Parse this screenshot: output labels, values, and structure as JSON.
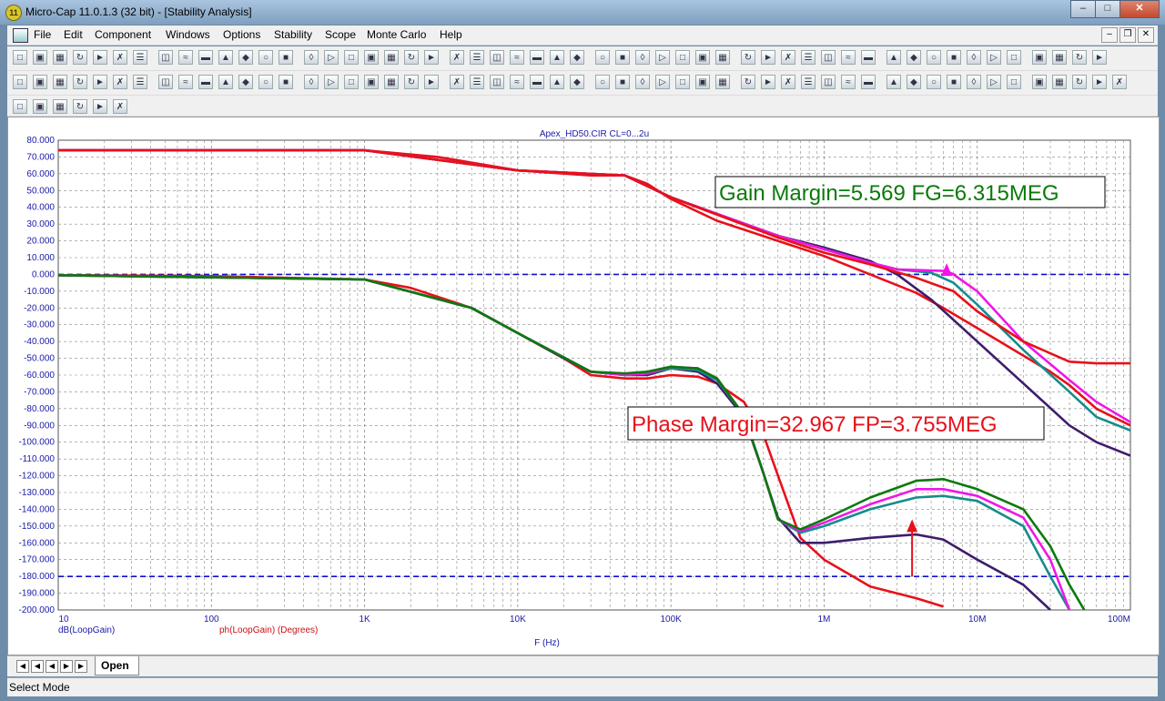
{
  "window": {
    "title": "Micro-Cap 11.0.1.3 (32 bit) - [Stability Analysis]",
    "app_icon_glyph": "11"
  },
  "menu": [
    "File",
    "Edit",
    "Component",
    "Windows",
    "Options",
    "Stability",
    "Scope",
    "Monte Carlo",
    "Help"
  ],
  "plot": {
    "title": "Apex_HD50.CIR CL=0...2u",
    "xlabel": "F (Hz)",
    "legend_left": "dB(LoopGain)",
    "legend_right": "ph(LoopGain) (Degrees)",
    "gain_annotation": "Gain Margin=5.569 FG=6.315MEG",
    "phase_annotation": "Phase Margin=32.967 FP=3.755MEG"
  },
  "tabs": {
    "active": "Open"
  },
  "status": "Select Mode",
  "chart_data": {
    "type": "line",
    "x_scale": "log",
    "xlim": [
      10,
      100000000
    ],
    "ylim": [
      -200,
      80
    ],
    "x_ticks": [
      "10",
      "100",
      "1K",
      "10K",
      "100K",
      "1M",
      "10M",
      "100M"
    ],
    "y_ticks": [
      "80.000",
      "70.000",
      "60.000",
      "50.000",
      "40.000",
      "30.000",
      "20.000",
      "10.000",
      "0.000",
      "-10.000",
      "-20.000",
      "-30.000",
      "-40.000",
      "-50.000",
      "-60.000",
      "-70.000",
      "-80.000",
      "-90.000",
      "-100.000",
      "-110.000",
      "-120.000",
      "-130.000",
      "-140.000",
      "-150.000",
      "-160.000",
      "-170.000",
      "-180.000",
      "-190.000",
      "-200.000"
    ],
    "grid": true,
    "reference_lines": [
      0,
      -180
    ],
    "colors": {
      "red": "#e8101a",
      "purple": "#3e1d6a",
      "teal": "#178c8c",
      "magenta": "#f016e8",
      "green": "#0a7a0a",
      "ref": "#1010d0"
    },
    "gain_series": [
      {
        "color": "red",
        "points": [
          [
            10,
            74
          ],
          [
            100,
            74
          ],
          [
            1000,
            74
          ],
          [
            3000,
            70
          ],
          [
            10000,
            62
          ],
          [
            30000,
            59
          ],
          [
            50000,
            59
          ],
          [
            70000,
            54
          ],
          [
            100000,
            45
          ],
          [
            200000,
            32
          ],
          [
            500000,
            20
          ],
          [
            1000000,
            11
          ],
          [
            2000000,
            0
          ],
          [
            4000000,
            -11
          ],
          [
            6000000,
            -20
          ],
          [
            10000000,
            -32
          ],
          [
            30000000,
            -58
          ],
          [
            40000000,
            -66
          ],
          [
            60000000,
            -80
          ],
          [
            100000000,
            -90
          ]
        ]
      },
      {
        "color": "purple",
        "points": [
          [
            10,
            74
          ],
          [
            1000,
            74
          ],
          [
            10000,
            62
          ],
          [
            50000,
            59
          ],
          [
            100000,
            46
          ],
          [
            500000,
            23
          ],
          [
            1000000,
            16
          ],
          [
            2000000,
            8
          ],
          [
            3000000,
            0
          ],
          [
            5000000,
            -15
          ],
          [
            10000000,
            -40
          ],
          [
            20000000,
            -65
          ],
          [
            40000000,
            -90
          ],
          [
            60000000,
            -100
          ],
          [
            100000000,
            -108
          ]
        ]
      },
      {
        "color": "teal",
        "points": [
          [
            10,
            74
          ],
          [
            1000,
            74
          ],
          [
            10000,
            62
          ],
          [
            50000,
            59
          ],
          [
            100000,
            46
          ],
          [
            500000,
            23
          ],
          [
            1000000,
            15
          ],
          [
            2000000,
            7
          ],
          [
            3000000,
            3
          ],
          [
            5000000,
            1
          ],
          [
            7000000,
            -5
          ],
          [
            10000000,
            -18
          ],
          [
            20000000,
            -45
          ],
          [
            40000000,
            -70
          ],
          [
            60000000,
            -85
          ],
          [
            100000000,
            -93
          ]
        ]
      },
      {
        "color": "magenta",
        "points": [
          [
            10,
            74
          ],
          [
            1000,
            74
          ],
          [
            10000,
            62
          ],
          [
            50000,
            59
          ],
          [
            100000,
            46
          ],
          [
            500000,
            23
          ],
          [
            1000000,
            15
          ],
          [
            2000000,
            7
          ],
          [
            3000000,
            3
          ],
          [
            6315000,
            2
          ],
          [
            7000000,
            0
          ],
          [
            10000000,
            -10
          ],
          [
            20000000,
            -40
          ],
          [
            40000000,
            -63
          ],
          [
            60000000,
            -76
          ],
          [
            100000000,
            -88
          ]
        ]
      },
      {
        "color": "red",
        "points": [
          [
            10,
            74
          ],
          [
            1000,
            74
          ],
          [
            10000,
            62
          ],
          [
            50000,
            59
          ],
          [
            100000,
            46
          ],
          [
            500000,
            22
          ],
          [
            1000000,
            13
          ],
          [
            2000000,
            6
          ],
          [
            4000000,
            -2
          ],
          [
            7000000,
            -10
          ],
          [
            10000000,
            -22
          ],
          [
            20000000,
            -40
          ],
          [
            40000000,
            -52
          ],
          [
            60000000,
            -53
          ],
          [
            100000000,
            -53
          ]
        ]
      }
    ],
    "phase_series": [
      {
        "color": "red",
        "points": [
          [
            10,
            -0.5
          ],
          [
            100,
            -1
          ],
          [
            1000,
            -3
          ],
          [
            2000,
            -8
          ],
          [
            5000,
            -20
          ],
          [
            10000,
            -35
          ],
          [
            20000,
            -50
          ],
          [
            30000,
            -60
          ],
          [
            50000,
            -62
          ],
          [
            70000,
            -62
          ],
          [
            100000,
            -60
          ],
          [
            150000,
            -61
          ],
          [
            200000,
            -65
          ],
          [
            300000,
            -76
          ],
          [
            400000,
            -95
          ],
          [
            500000,
            -120
          ],
          [
            600000,
            -140
          ],
          [
            700000,
            -157
          ],
          [
            1000000,
            -170
          ],
          [
            2000000,
            -186
          ],
          [
            4000000,
            -193
          ],
          [
            6000000,
            -198
          ]
        ]
      },
      {
        "color": "purple",
        "points": [
          [
            10,
            -0.5
          ],
          [
            1000,
            -3
          ],
          [
            5000,
            -20
          ],
          [
            10000,
            -35
          ],
          [
            20000,
            -50
          ],
          [
            30000,
            -58
          ],
          [
            50000,
            -60
          ],
          [
            70000,
            -60
          ],
          [
            100000,
            -56
          ],
          [
            150000,
            -58
          ],
          [
            200000,
            -65
          ],
          [
            300000,
            -85
          ],
          [
            400000,
            -118
          ],
          [
            500000,
            -145
          ],
          [
            700000,
            -160
          ],
          [
            1000000,
            -160
          ],
          [
            2000000,
            -157
          ],
          [
            4000000,
            -155
          ],
          [
            6000000,
            -158
          ],
          [
            10000000,
            -170
          ],
          [
            20000000,
            -185
          ],
          [
            30000000,
            -200
          ]
        ]
      },
      {
        "color": "teal",
        "points": [
          [
            10,
            -0.5
          ],
          [
            1000,
            -3
          ],
          [
            5000,
            -20
          ],
          [
            10000,
            -35
          ],
          [
            30000,
            -58
          ],
          [
            50000,
            -60
          ],
          [
            70000,
            -59
          ],
          [
            100000,
            -56
          ],
          [
            150000,
            -57
          ],
          [
            200000,
            -63
          ],
          [
            300000,
            -84
          ],
          [
            400000,
            -118
          ],
          [
            500000,
            -146
          ],
          [
            700000,
            -154
          ],
          [
            1000000,
            -150
          ],
          [
            2000000,
            -140
          ],
          [
            4000000,
            -133
          ],
          [
            6000000,
            -132
          ],
          [
            10000000,
            -135
          ],
          [
            20000000,
            -150
          ],
          [
            30000000,
            -180
          ],
          [
            40000000,
            -200
          ]
        ]
      },
      {
        "color": "magenta",
        "points": [
          [
            10,
            -0.5
          ],
          [
            1000,
            -3
          ],
          [
            5000,
            -20
          ],
          [
            10000,
            -35
          ],
          [
            30000,
            -58
          ],
          [
            50000,
            -60
          ],
          [
            70000,
            -59
          ],
          [
            100000,
            -55
          ],
          [
            150000,
            -56
          ],
          [
            200000,
            -62
          ],
          [
            300000,
            -84
          ],
          [
            400000,
            -118
          ],
          [
            500000,
            -146
          ],
          [
            700000,
            -153
          ],
          [
            1000000,
            -148
          ],
          [
            2000000,
            -137
          ],
          [
            4000000,
            -128
          ],
          [
            6000000,
            -128
          ],
          [
            10000000,
            -132
          ],
          [
            20000000,
            -145
          ],
          [
            30000000,
            -170
          ],
          [
            40000000,
            -200
          ]
        ]
      },
      {
        "color": "green",
        "points": [
          [
            10,
            -0.5
          ],
          [
            1000,
            -3
          ],
          [
            5000,
            -20
          ],
          [
            10000,
            -35
          ],
          [
            30000,
            -58
          ],
          [
            50000,
            -59
          ],
          [
            70000,
            -58
          ],
          [
            100000,
            -55
          ],
          [
            150000,
            -56
          ],
          [
            200000,
            -62
          ],
          [
            300000,
            -84
          ],
          [
            400000,
            -118
          ],
          [
            500000,
            -146
          ],
          [
            700000,
            -152
          ],
          [
            1000000,
            -146
          ],
          [
            2000000,
            -133
          ],
          [
            4000000,
            -123
          ],
          [
            6000000,
            -122
          ],
          [
            10000000,
            -128
          ],
          [
            20000000,
            -140
          ],
          [
            30000000,
            -162
          ],
          [
            40000000,
            -185
          ],
          [
            50000000,
            -200
          ]
        ]
      }
    ],
    "markers": [
      {
        "kind": "gain",
        "x": 6315000,
        "from": 0,
        "to": 5.569
      },
      {
        "kind": "phase",
        "x": 3755000,
        "from": -180,
        "to": -147
      }
    ]
  }
}
